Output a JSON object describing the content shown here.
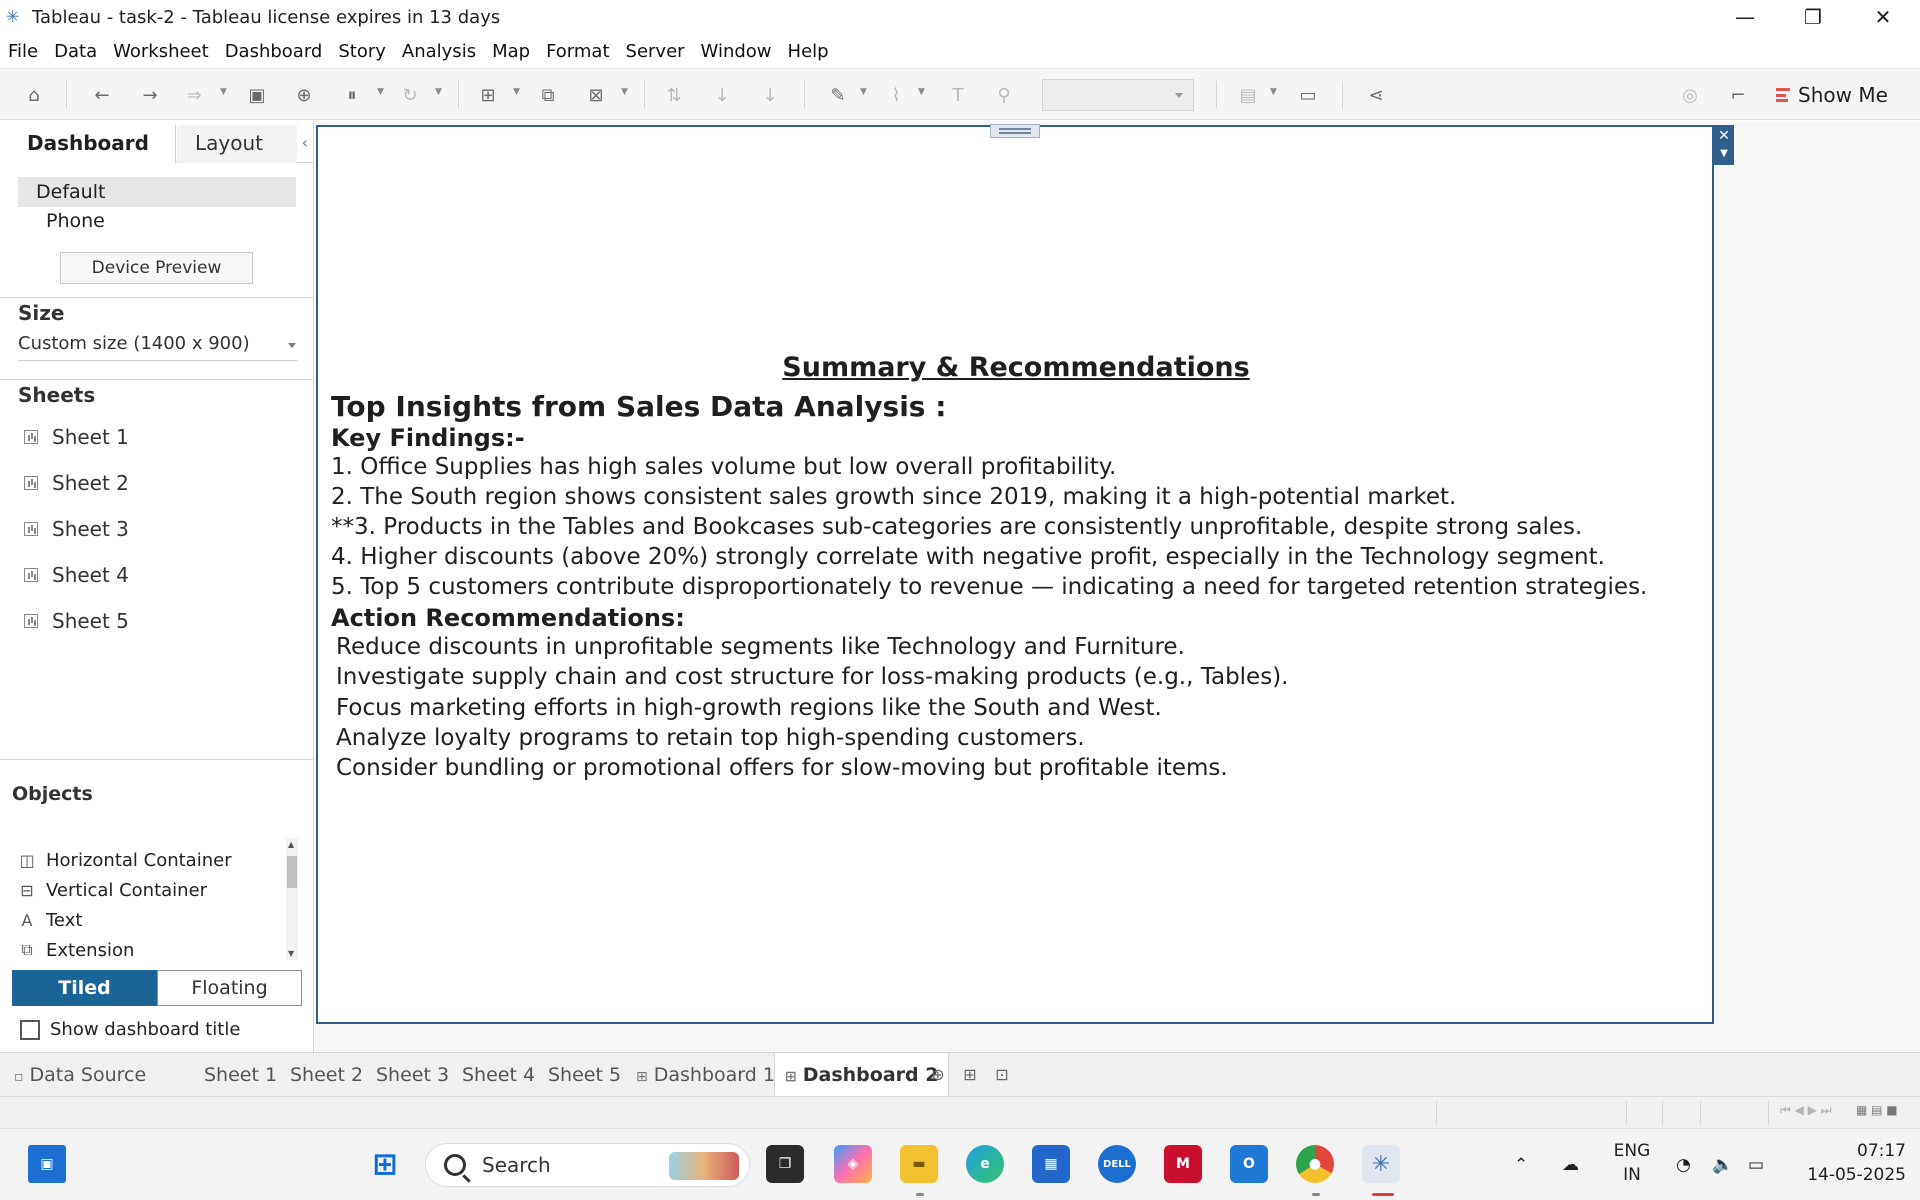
{
  "window": {
    "title": "Tableau - task-2 - Tableau license expires in 13 days",
    "minimize_glyph": "—",
    "maximize_glyph": "❐",
    "close_glyph": "✕"
  },
  "menu": [
    "File",
    "Data",
    "Worksheet",
    "Dashboard",
    "Story",
    "Analysis",
    "Map",
    "Format",
    "Server",
    "Window",
    "Help"
  ],
  "toolbar": {
    "show_me_label": "Show Me",
    "icons": [
      "home-icon",
      "undo-icon",
      "redo-icon",
      "replay-icon",
      "save-icon",
      "new-datasource-icon",
      "pause-updates-icon",
      "refresh-icon",
      "new-worksheet-icon",
      "duplicate-icon",
      "clear-sheet-icon",
      "swap-icon",
      "sort-ascending-icon",
      "sort-descending-icon",
      "highlight-icon",
      "group-icon",
      "labels-icon",
      "fix-axes-icon",
      "fit-select",
      "show-cards-icon",
      "presentation-mode-icon",
      "share-icon",
      "data-guide-icon",
      "format-painter-icon"
    ]
  },
  "left_panel": {
    "tabs": {
      "dashboard": "Dashboard",
      "layout": "Layout"
    },
    "collapse_glyph": "‹",
    "devices": {
      "default": "Default",
      "phone": "Phone",
      "preview_button": "Device Preview"
    },
    "size": {
      "title": "Size",
      "value": "Custom size (1400 x 900)"
    },
    "sheets": {
      "title": "Sheets",
      "items": [
        "Sheet 1",
        "Sheet 2",
        "Sheet 3",
        "Sheet 4",
        "Sheet 5"
      ]
    },
    "objects": {
      "title": "Objects",
      "items": [
        {
          "label": "Horizontal Container",
          "icon": "horizontal-container-icon",
          "glyph": "◫"
        },
        {
          "label": "Vertical Container",
          "icon": "vertical-container-icon",
          "glyph": "⊟"
        },
        {
          "label": "Text",
          "icon": "text-icon",
          "glyph": "A"
        },
        {
          "label": "Extension",
          "icon": "extension-icon",
          "glyph": "⧉"
        }
      ]
    },
    "layout_toggle": {
      "tiled": "Tiled",
      "floating": "Floating",
      "selected": "Tiled"
    },
    "show_dashboard_title": {
      "label": "Show dashboard title",
      "checked": false
    }
  },
  "dashboard": {
    "summary_title": "Summary & Recommendations",
    "heading": "Top Insights from Sales Data Analysis :",
    "key_findings_label": "Key Findings:-",
    "findings": [
      "1. Office Supplies has high sales volume but low overall profitability.",
      "2. The South region shows consistent sales growth since 2019, making it a high-potential market.",
      "**3. Products in the Tables and Bookcases sub-categories are consistently unprofitable, despite strong sales.",
      "4. Higher discounts (above 20%) strongly correlate with negative profit, especially in the Technology segment.",
      "5. Top 5 customers contribute disproportionately to revenue — indicating a need for targeted retention strategies."
    ],
    "recommendations_label": "Action Recommendations:",
    "recommendations": [
      "Reduce discounts in unprofitable segments like Technology and Furniture.",
      "Investigate supply chain and cost structure for loss-making products (e.g., Tables).",
      "Focus marketing efforts in high-growth regions like the South and West.",
      "Analyze loyalty programs to retain top high-spending customers.",
      "Consider bundling or promotional offers for slow-moving but profitable items."
    ]
  },
  "sheet_tabs": {
    "data_source": "Data Source",
    "sheets": [
      "Sheet 1",
      "Sheet 2",
      "Sheet 3",
      "Sheet 4",
      "Sheet 5"
    ],
    "dashboards": [
      "Dashboard 1",
      "Dashboard 2"
    ],
    "active": "Dashboard 2"
  },
  "taskbar": {
    "search_label": "Search",
    "language": {
      "line1": "ENG",
      "line2": "IN"
    },
    "clock": {
      "time": "07:17",
      "date": "14-05-2025"
    },
    "apps": [
      "widgets-icon",
      "start-icon",
      "task-view-icon",
      "copilot-icon",
      "file-explorer-icon",
      "edge-icon",
      "store-icon",
      "dell-icon",
      "mcafee-icon",
      "outlook-icon",
      "chrome-icon",
      "tableau-icon"
    ],
    "tray": [
      "chevron-up-icon",
      "onedrive-icon",
      "wifi-icon",
      "volume-icon",
      "battery-icon"
    ]
  }
}
